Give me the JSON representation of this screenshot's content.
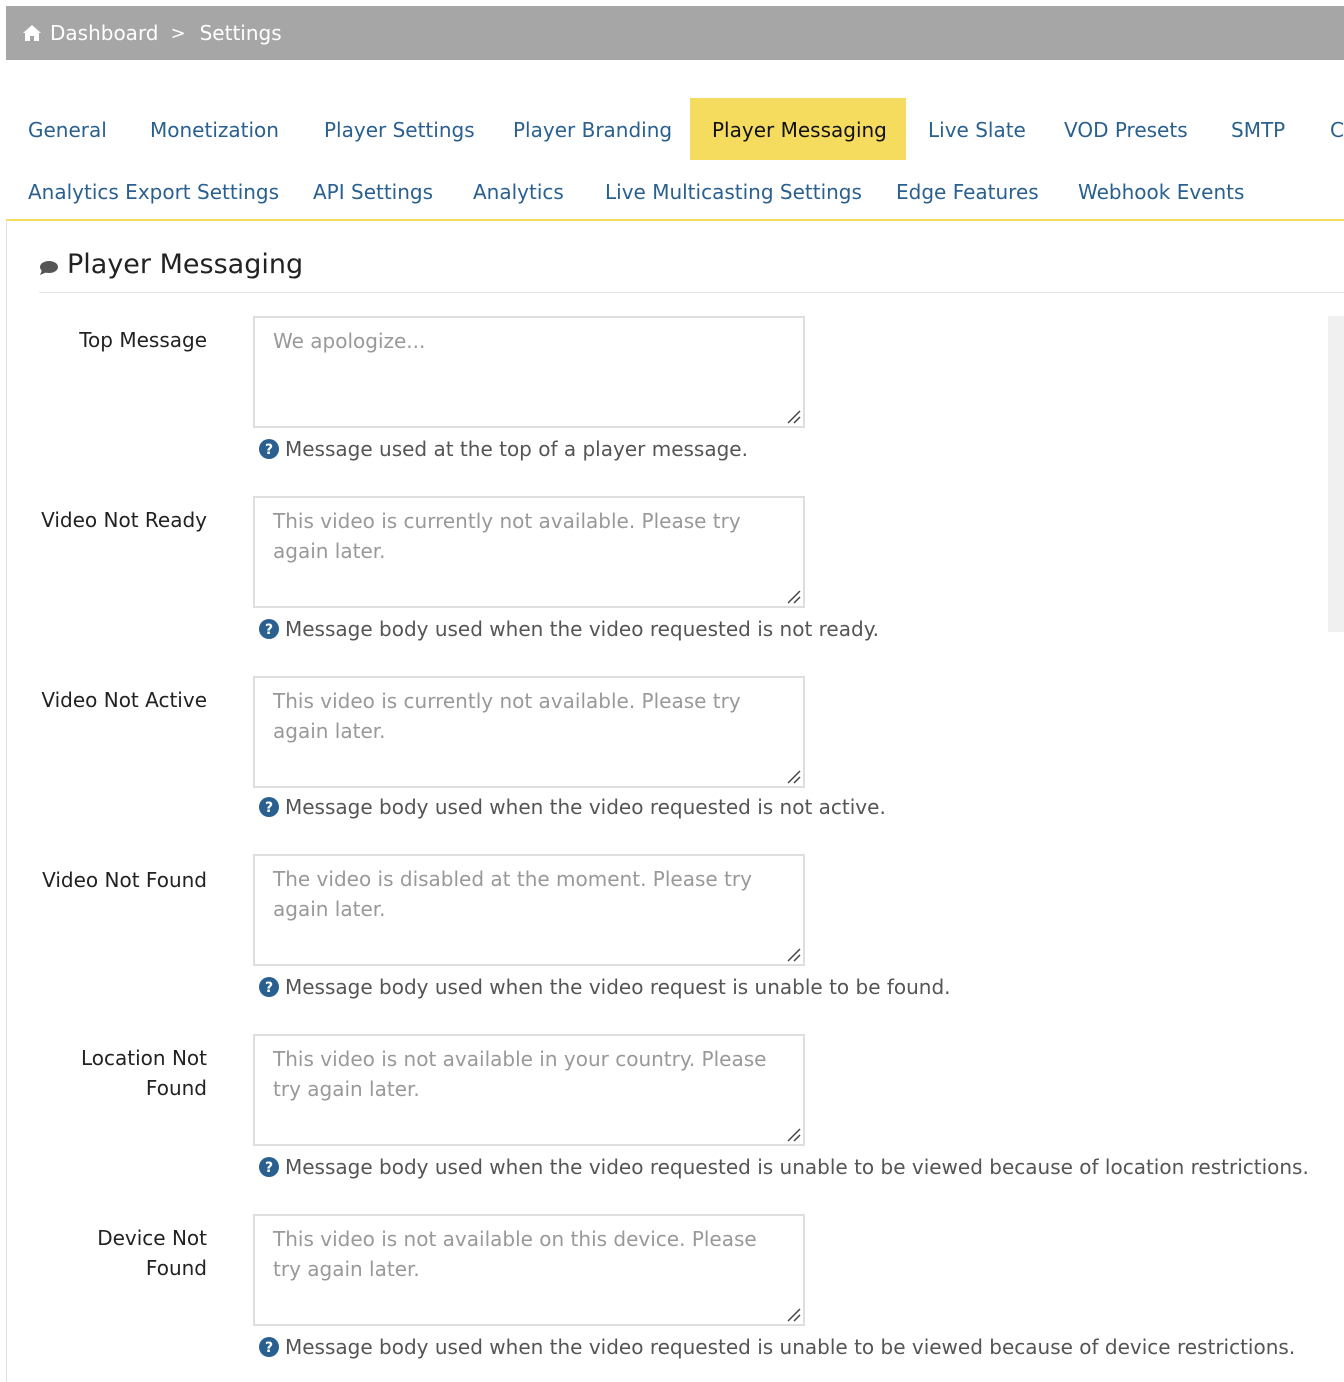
{
  "breadcrumb": {
    "home_icon": "home-icon",
    "items": [
      "Dashboard",
      "Settings"
    ],
    "separator": ">"
  },
  "tabs": [
    {
      "label": "General"
    },
    {
      "label": "Monetization"
    },
    {
      "label": "Player Settings"
    },
    {
      "label": "Player Branding"
    },
    {
      "label": "Player Messaging",
      "active": true
    },
    {
      "label": "Live Slate"
    },
    {
      "label": "VOD Presets"
    },
    {
      "label": "SMTP"
    },
    {
      "label": "C"
    },
    {
      "label": "Analytics Export Settings"
    },
    {
      "label": "API Settings"
    },
    {
      "label": "Analytics"
    },
    {
      "label": "Live Multicasting Settings"
    },
    {
      "label": "Edge Features"
    },
    {
      "label": "Webhook Events"
    }
  ],
  "panel": {
    "icon": "chat-bubble-icon",
    "title": "Player Messaging"
  },
  "fields": [
    {
      "label": "Top Message",
      "placeholder": "We apologize...",
      "help": "Message used at the top of a player message."
    },
    {
      "label": "Video Not Ready",
      "placeholder": "This video is currently not available. Please try again later.",
      "help": "Message body used when the video requested is not ready."
    },
    {
      "label": "Video Not Active",
      "placeholder": "This video is currently not available. Please try again later.",
      "help": "Message body used when the video requested is not active."
    },
    {
      "label": "Video Not Found",
      "placeholder": "The video is disabled at the moment.  Please try again later.",
      "help": "Message body used when the video request is unable to be found."
    },
    {
      "label": "Location Not Found",
      "placeholder": "This video is not available in your country. Please try again later.",
      "help": "Message body used when the video requested is unable to be viewed because of location restrictions."
    },
    {
      "label": "Device Not Found",
      "placeholder": "This video is not available on this device. Please try again later.",
      "help": "Message body used when the video requested is unable to be viewed because of device restrictions."
    }
  ],
  "colors": {
    "breadcrumb_bg": "#a6a6a6",
    "tab_link": "#2a6090",
    "tab_active_bg": "#f5dc5f",
    "help_icon": "#2a6090",
    "placeholder_text": "#999999"
  }
}
